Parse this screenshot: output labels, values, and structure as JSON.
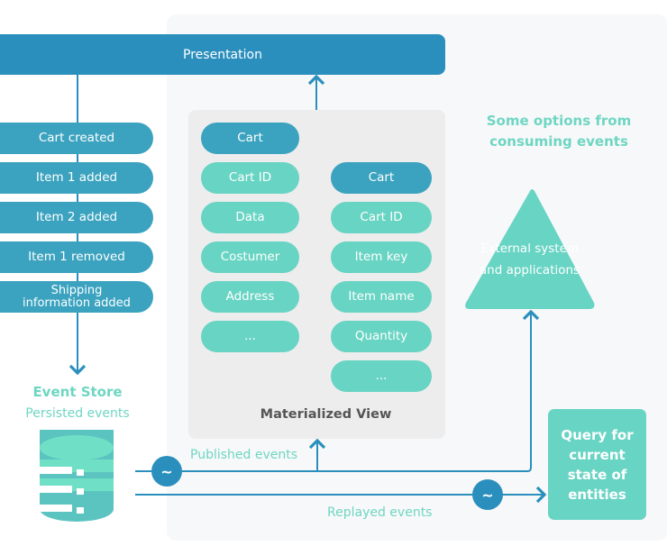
{
  "presentation": {
    "label": "Presentation"
  },
  "event_stream": {
    "items": [
      "Cart created",
      "Item 1 added",
      "Item 2 added",
      "Item 1 removed",
      "Shipping information added"
    ]
  },
  "event_store": {
    "title": "Event Store",
    "subtitle": "Persisted events",
    "icon": "database-icon"
  },
  "materialized_view": {
    "title": "Materialized View",
    "left_entity": {
      "header": "Cart",
      "fields": [
        "Cart ID",
        "Data",
        "Costumer",
        "Address",
        "..."
      ]
    },
    "right_entity": {
      "header": "Cart",
      "fields": [
        "Cart ID",
        "Item key",
        "Item name",
        "Quantity",
        "..."
      ]
    }
  },
  "options": {
    "heading": "Some options from consuming events",
    "external": "External system and applications",
    "query": "Query for current state of entities"
  },
  "flows": {
    "published": "Published events",
    "replayed": "Replayed events",
    "tilde_symbol": "~"
  },
  "colors": {
    "primary_blue": "#2b8fbd",
    "event_blue": "#3ba3bf",
    "teal": "#68d4c3",
    "panel_bg": "#f7f8fa",
    "view_bg": "#ededed"
  }
}
